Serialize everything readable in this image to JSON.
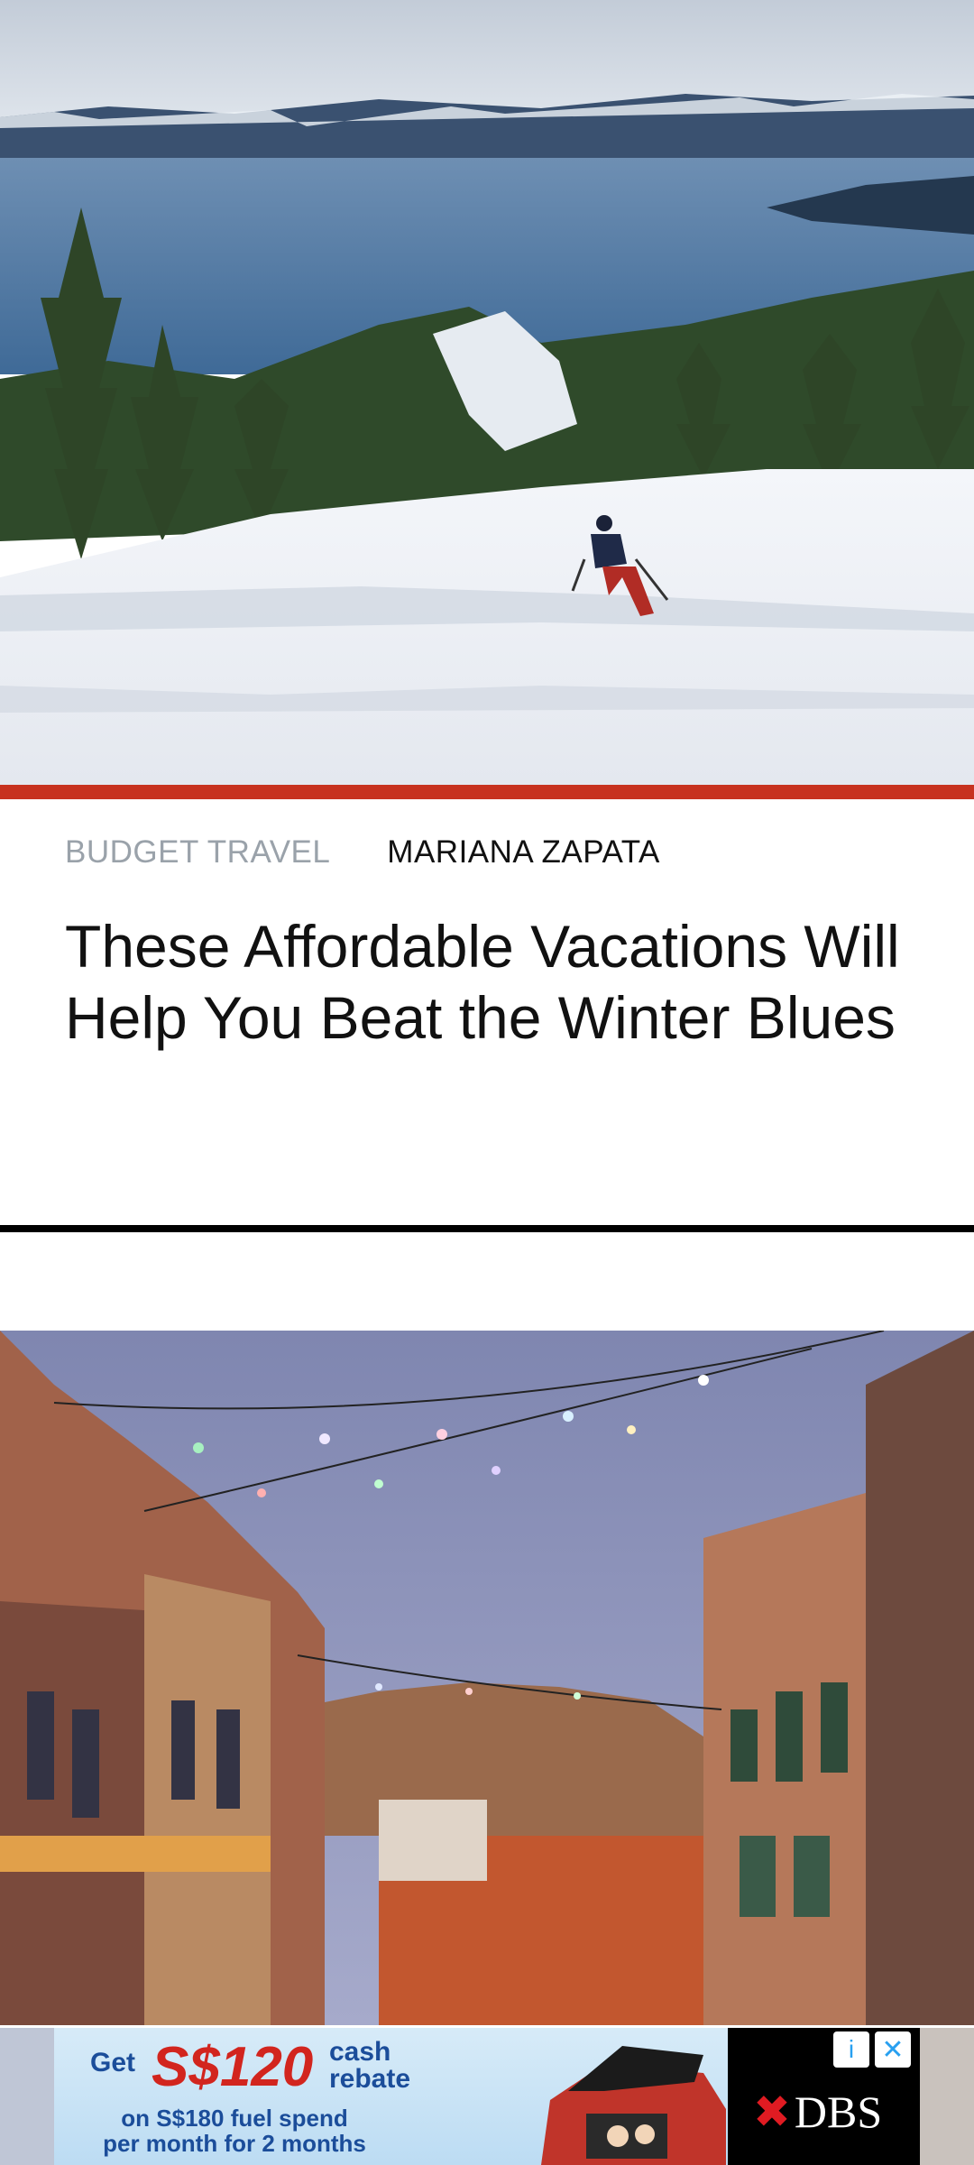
{
  "article1": {
    "category": "BUDGET TRAVEL",
    "author": "MARIANA ZAPATA",
    "title": "These Affordable Vacations Will Help You Beat the Winter Blues"
  },
  "ad": {
    "get": "Get",
    "amount": "S$120",
    "cash_line1": "cash",
    "cash_line2": "rebate",
    "sub_line1": "on S$180 fuel spend",
    "sub_line2": "per month for 2 months",
    "brand": "DBS",
    "info_icon": "i",
    "close_icon": "✕"
  },
  "colors": {
    "accent": "#c7321f",
    "ad_red": "#d2251e",
    "ad_blue": "#1b4d9a"
  }
}
